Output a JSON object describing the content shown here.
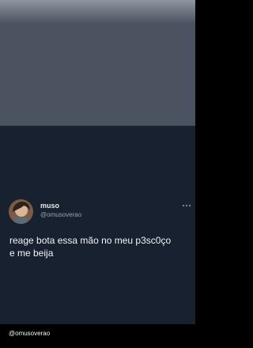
{
  "tweet": {
    "display_name": "muso",
    "handle": "@omusoverao",
    "text": "reage bota essa mão no meu p3sc0ço\ne me beija"
  },
  "watermark": {
    "handle": "@omusoverao"
  },
  "colors": {
    "top_panel": "#4b5260",
    "tweet_bg": "#172130",
    "text": "#f3f5f7",
    "secondary_text": "#9aa3ad"
  },
  "icons": {
    "avatar": "avatar-photo",
    "more": "more-horizontal-icon"
  }
}
